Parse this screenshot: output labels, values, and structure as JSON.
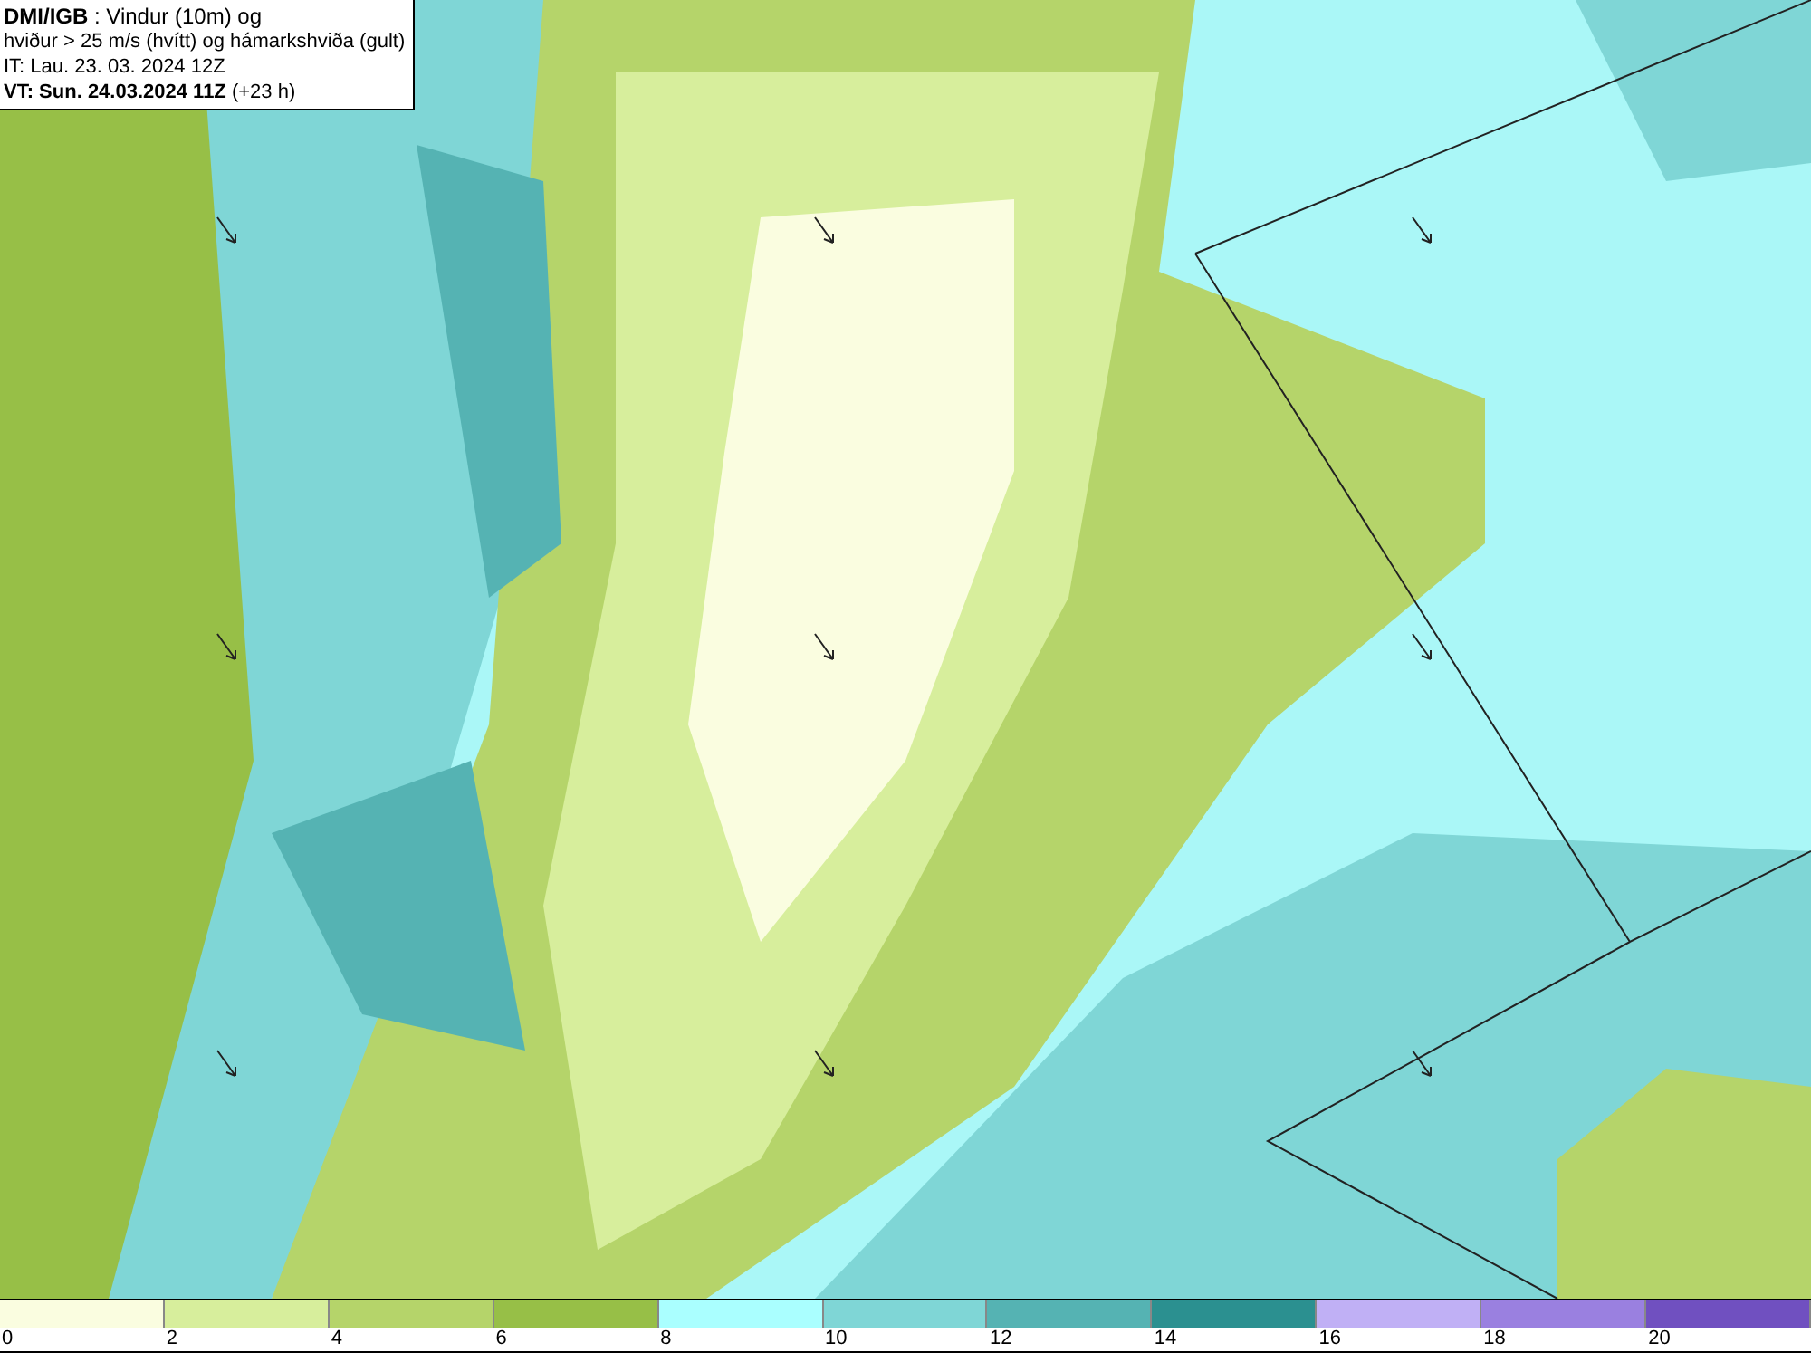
{
  "header": {
    "lines": [
      "**DMI/IGB** : Vindur (10m) og",
      "hviður > 25 m/s (hvítt) og hámarkshviða (gult)",
      "IT: Lau. 23. 03. 2024 12Z",
      "**VT: Sun. 24.03.2024 11Z** (+23 h)"
    ]
  },
  "legend": {
    "bins": [
      {
        "label": "0",
        "color": "#fafde0"
      },
      {
        "label": "2",
        "color": "#d7ee9c"
      },
      {
        "label": "4",
        "color": "#b5d46a"
      },
      {
        "label": "6",
        "color": "#97bf47"
      },
      {
        "label": "8",
        "color": "#aaffff"
      },
      {
        "label": "10",
        "color": "#7fd6d6"
      },
      {
        "label": "12",
        "color": "#55b3b3"
      },
      {
        "label": "14",
        "color": "#2b9090"
      },
      {
        "label": "16",
        "color": "#c0b0f5"
      },
      {
        "label": "18",
        "color": "#9a80e0"
      },
      {
        "label": "20",
        "color": "#7050c0"
      }
    ]
  }
}
